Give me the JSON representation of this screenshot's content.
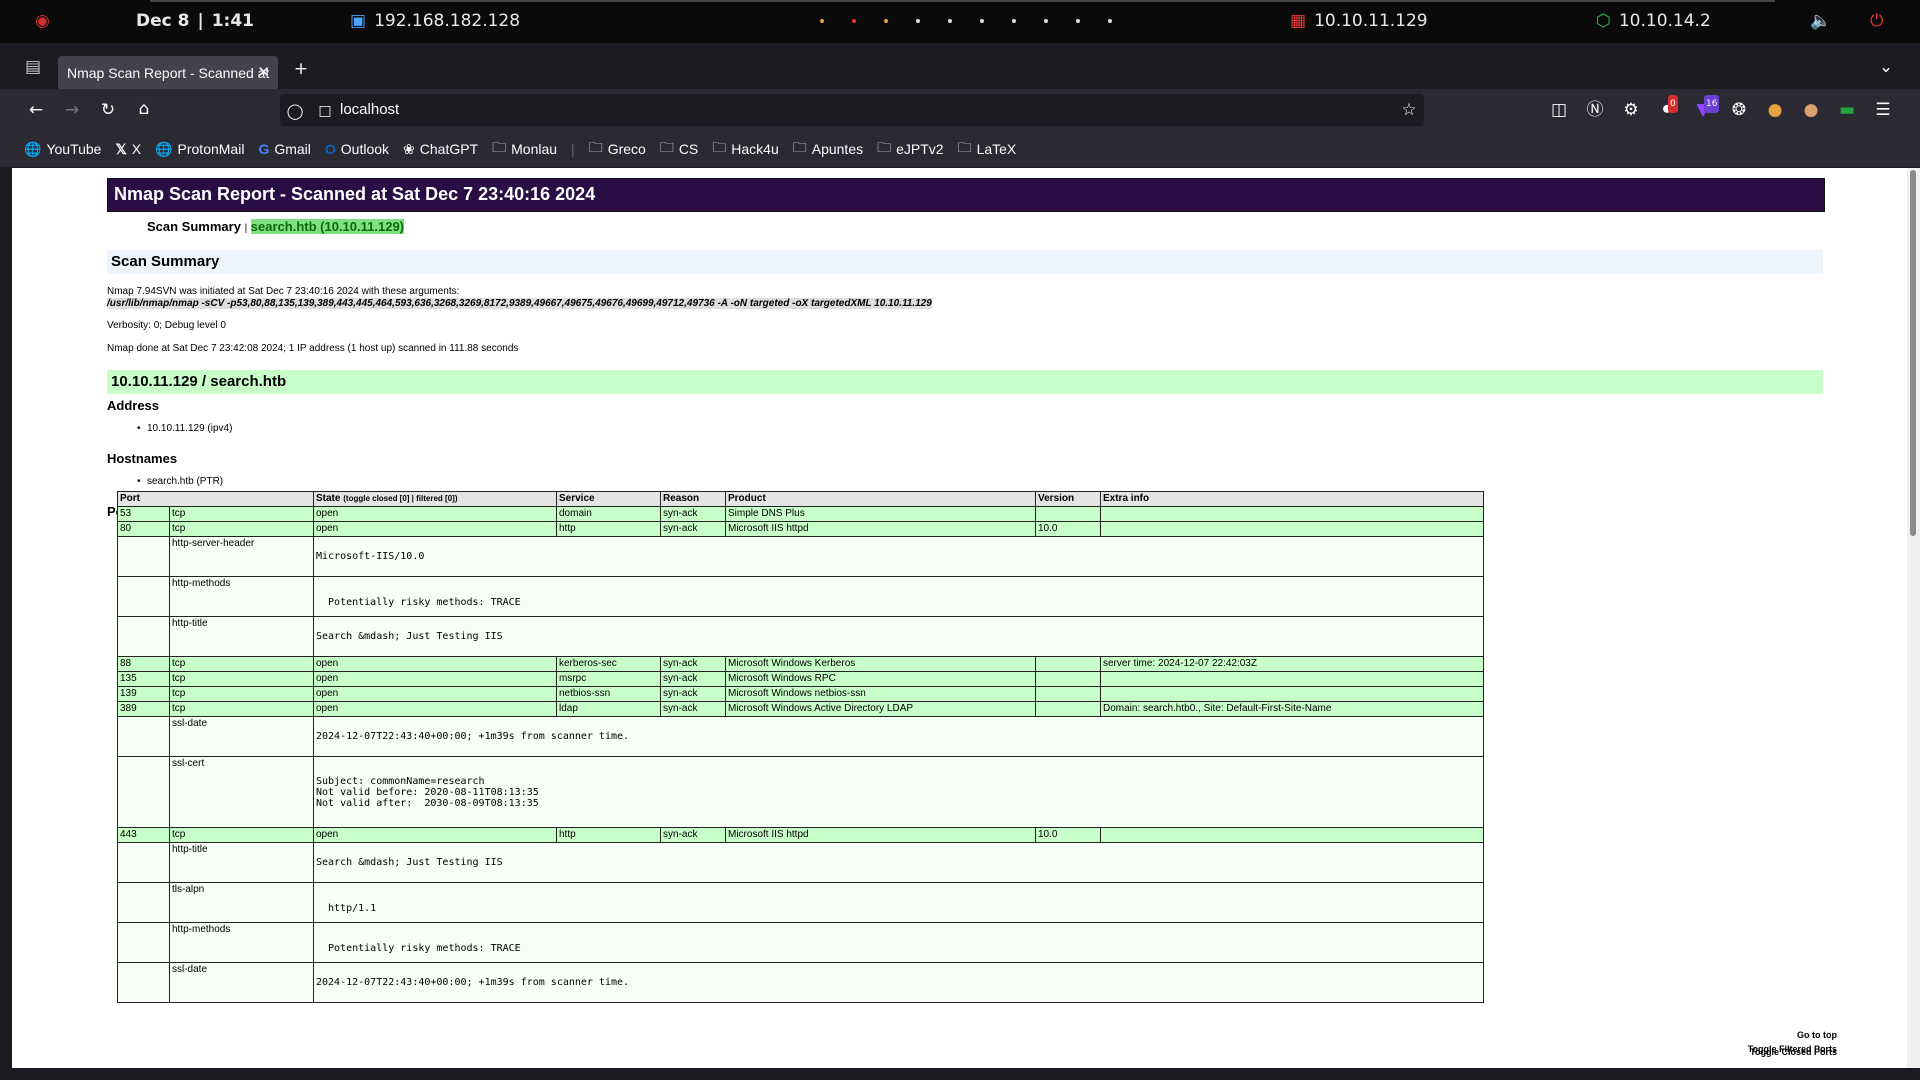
{
  "taskbar": {
    "date": "Dec 8",
    "time": "1:41",
    "ip_local": "192.168.182.128",
    "ip_target": "10.10.11.129",
    "ip_vpn": "10.10.14.2"
  },
  "browser": {
    "tab_title": "Nmap Scan Report - Scanned at",
    "url": "localhost",
    "bookmarks": [
      "YouTube",
      "X",
      "ProtonMail",
      "Gmail",
      "Outlook",
      "ChatGPT",
      "Monlau",
      "Greco",
      "CS",
      "Hack4u",
      "Apuntes",
      "eJPTv2",
      "LaTeX"
    ],
    "badges": {
      "shield": "0",
      "twitch": "16"
    }
  },
  "report": {
    "title": "Nmap Scan Report - Scanned at Sat Dec 7 23:40:16 2024",
    "crumb_left": "Scan Summary",
    "crumb_sep": "|",
    "crumb_right": "search.htb (10.10.11.129)",
    "summary_heading": "Scan Summary",
    "summary_line1": "Nmap 7.94SVN was initiated at Sat Dec 7 23:40:16 2024 with these arguments:",
    "summary_args": "/usr/lib/nmap/nmap -sCV -p53,80,88,135,139,389,443,445,464,593,636,3268,3269,8172,9389,49667,49675,49676,49699,49712,49736 -A -oN targeted -oX targetedXML 10.10.11.129",
    "verbosity": "Verbosity: 0; Debug level 0",
    "done": "Nmap done at Sat Dec 7 23:42:08 2024; 1 IP address (1 host up) scanned in 111.88 seconds",
    "host_heading": "10.10.11.129 / search.htb",
    "address_heading": "Address",
    "address": "10.10.11.129 (ipv4)",
    "hostnames_heading": "Hostnames",
    "hostname": "search.htb (PTR)",
    "ports_heading": "Ports",
    "columns": {
      "port": "Port",
      "state": "State",
      "state_toggle": "(toggle closed [0] | filtered [0])",
      "service": "Service",
      "reason": "Reason",
      "product": "Product",
      "version": "Version",
      "extra": "Extra info"
    },
    "rows": [
      {
        "type": "port",
        "port": "53",
        "proto": "tcp",
        "state": "open",
        "service": "domain",
        "reason": "syn-ack",
        "product": "Simple DNS Plus",
        "version": "",
        "extra": ""
      },
      {
        "type": "port",
        "port": "80",
        "proto": "tcp",
        "state": "open",
        "service": "http",
        "reason": "syn-ack",
        "product": "Microsoft IIS httpd",
        "version": "10.0",
        "extra": ""
      },
      {
        "type": "script",
        "name": "http-server-header",
        "value": "Microsoft-IIS/10.0",
        "h": 40
      },
      {
        "type": "script",
        "name": "http-methods",
        "value": "\n  Potentially risky methods: TRACE",
        "h": 40
      },
      {
        "type": "script",
        "name": "http-title",
        "value": "Search &mdash; Just Testing IIS",
        "h": 40
      },
      {
        "type": "port",
        "port": "88",
        "proto": "tcp",
        "state": "open",
        "service": "kerberos-sec",
        "reason": "syn-ack",
        "product": "Microsoft Windows Kerberos",
        "version": "",
        "extra": "server time: 2024-12-07 22:42:03Z"
      },
      {
        "type": "port",
        "port": "135",
        "proto": "tcp",
        "state": "open",
        "service": "msrpc",
        "reason": "syn-ack",
        "product": "Microsoft Windows RPC",
        "version": "",
        "extra": ""
      },
      {
        "type": "port",
        "port": "139",
        "proto": "tcp",
        "state": "open",
        "service": "netbios-ssn",
        "reason": "syn-ack",
        "product": "Microsoft Windows netbios-ssn",
        "version": "",
        "extra": ""
      },
      {
        "type": "port",
        "port": "389",
        "proto": "tcp",
        "state": "open",
        "service": "ldap",
        "reason": "syn-ack",
        "product": "Microsoft Windows Active Directory LDAP",
        "version": "",
        "extra": "Domain: search.htb0., Site: Default-First-Site-Name"
      },
      {
        "type": "script",
        "name": "ssl-date",
        "value": "2024-12-07T22:43:40+00:00; +1m39s from scanner time.",
        "h": 40
      },
      {
        "type": "script",
        "name": "ssl-cert",
        "value": "Subject: commonName=research\nNot valid before: 2020-08-11T08:13:35\nNot valid after:  2030-08-09T08:13:35",
        "h": 71
      },
      {
        "type": "port",
        "port": "443",
        "proto": "tcp",
        "state": "open",
        "service": "http",
        "reason": "syn-ack",
        "product": "Microsoft IIS httpd",
        "version": "10.0",
        "extra": ""
      },
      {
        "type": "script",
        "name": "http-title",
        "value": "Search &mdash; Just Testing IIS",
        "h": 40
      },
      {
        "type": "script",
        "name": "tls-alpn",
        "value": "\n  http/1.1",
        "h": 40
      },
      {
        "type": "script",
        "name": "http-methods",
        "value": "\n  Potentially risky methods: TRACE",
        "h": 40
      },
      {
        "type": "script",
        "name": "ssl-date",
        "value": "2024-12-07T22:43:40+00:00; +1m39s from scanner time.",
        "h": 40
      }
    ],
    "footer": [
      "Go to top",
      "Toggle Closed Ports",
      "Toggle Filtered Ports"
    ]
  }
}
